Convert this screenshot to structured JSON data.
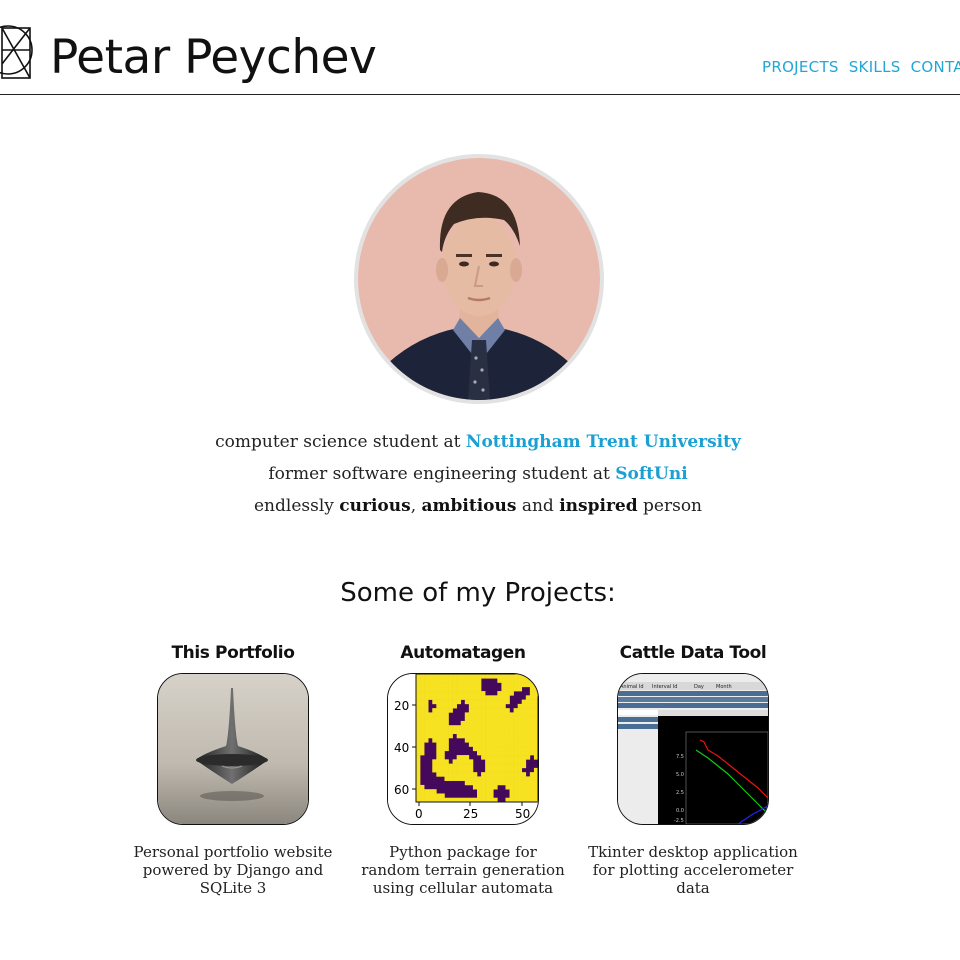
{
  "header": {
    "title": "Petar Peychev",
    "nav": [
      "PROJECTS",
      "SKILLS",
      "CONTACT"
    ]
  },
  "bio": {
    "line1_prefix": "computer science student at ",
    "line1_link": "Nottingham Trent University",
    "line2_prefix": "former software engineering student at ",
    "line2_link": "SoftUni",
    "line3_a": "endlessly ",
    "line3_b": "curious",
    "line3_c": ", ",
    "line3_d": "ambitious",
    "line3_e": " and ",
    "line3_f": "inspired",
    "line3_g": " person"
  },
  "projects_heading": "Some of my Projects:",
  "projects": [
    {
      "title": "This Portfolio",
      "description": "Personal portfolio website powered by Django and SQLite 3"
    },
    {
      "title": "Automatagen",
      "description": "Python package for random terrain generation using cellular automata"
    },
    {
      "title": "Cattle Data Tool",
      "description": "Tkinter desktop application for plotting accelerometer data"
    }
  ],
  "automatagen_thumb": {
    "y_ticks": [
      "20",
      "40",
      "60"
    ],
    "x_ticks": [
      "0",
      "25",
      "50"
    ]
  },
  "cattle_thumb": {
    "columns": [
      "Animal Id",
      "Interval Id",
      "Day",
      "Month"
    ],
    "y_ticks": [
      "7.5",
      "5.0",
      "2.5",
      "0.0",
      "-2.5"
    ]
  },
  "colors": {
    "link": "#1aa0d2",
    "nav": "#21a6d6",
    "automata_fill": "#f6e221",
    "automata_bg": "#44095a"
  }
}
